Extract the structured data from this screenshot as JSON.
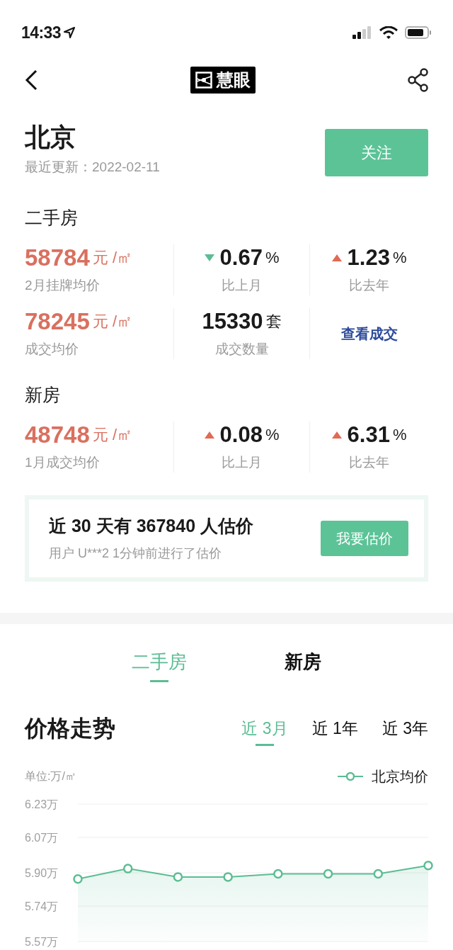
{
  "status_bar": {
    "time": "14:33"
  },
  "nav": {
    "logo": "慧眼"
  },
  "city": {
    "name": "北京",
    "updated": "最近更新：2022-02-11",
    "follow_button": "关注"
  },
  "sections": [
    {
      "title": "二手房",
      "rows": [
        [
          {
            "kind": "price",
            "value": "58784",
            "unit": "元 /㎡",
            "label": "2月挂牌均价"
          },
          {
            "kind": "change",
            "rising": false,
            "value": "0.67",
            "unit": "%",
            "label": "比上月"
          },
          {
            "kind": "change",
            "rising": true,
            "value": "1.23",
            "unit": "%",
            "label": "比去年"
          }
        ],
        [
          {
            "kind": "price",
            "value": "78245",
            "unit": "元 /㎡",
            "label": "成交均价"
          },
          {
            "kind": "count",
            "value": "15330",
            "unit": "套",
            "label": "成交数量"
          },
          {
            "kind": "link",
            "label": "查看成交"
          }
        ]
      ]
    },
    {
      "title": "新房",
      "rows": [
        [
          {
            "kind": "price",
            "value": "48748",
            "unit": "元 /㎡",
            "label": "1月成交均价"
          },
          {
            "kind": "change",
            "rising": true,
            "value": "0.08",
            "unit": "%",
            "label": "比上月"
          },
          {
            "kind": "change",
            "rising": true,
            "value": "6.31",
            "unit": "%",
            "label": "比去年"
          }
        ]
      ]
    }
  ],
  "estimate": {
    "headline": "近 30 天有 367840 人估价",
    "subline": "用户 U***2 1分钟前进行了估价",
    "button": "我要估价"
  },
  "tabs": [
    {
      "label": "二手房",
      "selected": true
    },
    {
      "label": "新房",
      "selected": false
    }
  ],
  "trend": {
    "title": "价格走势",
    "ranges": [
      {
        "label": "近 3月",
        "selected": true
      },
      {
        "label": "近 1年",
        "selected": false
      },
      {
        "label": "近 3年",
        "selected": false
      }
    ],
    "unit": "单位:万/㎡",
    "chart_data": {
      "type": "line",
      "grid": true,
      "ylim": [
        5.57,
        6.23
      ],
      "yticks": [
        {
          "value": 6.23,
          "label": "6.23万"
        },
        {
          "value": 6.07,
          "label": "6.07万"
        },
        {
          "value": 5.9,
          "label": "5.90万"
        },
        {
          "value": 5.74,
          "label": "5.74万"
        },
        {
          "value": 5.57,
          "label": "5.57万"
        }
      ],
      "series": [
        {
          "name": "北京均价",
          "color": "#5bbd94",
          "marker": "circle",
          "values": [
            5.87,
            5.92,
            5.88,
            5.88,
            5.895,
            5.895,
            5.895,
            5.935
          ]
        }
      ]
    }
  }
}
